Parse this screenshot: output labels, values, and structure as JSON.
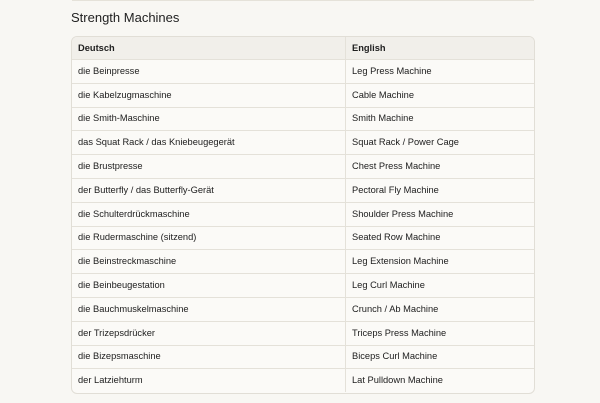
{
  "section": {
    "title": "Strength Machines"
  },
  "table": {
    "headers": [
      "Deutsch",
      "English"
    ],
    "rows": [
      [
        "die Beinpresse",
        "Leg Press Machine"
      ],
      [
        "die Kabelzugmaschine",
        "Cable Machine"
      ],
      [
        "die Smith-Maschine",
        "Smith Machine"
      ],
      [
        "das Squat Rack / das Kniebeugegerät",
        "Squat Rack / Power Cage"
      ],
      [
        "die Brustpresse",
        "Chest Press Machine"
      ],
      [
        "der Butterfly / das Butterfly-Gerät",
        "Pectoral Fly Machine"
      ],
      [
        "die Schulterdrückmaschine",
        "Shoulder Press Machine"
      ],
      [
        "die Rudermaschine (sitzend)",
        "Seated Row Machine"
      ],
      [
        "die Beinstreckmaschine",
        "Leg Extension Machine"
      ],
      [
        "die Beinbeugestation",
        "Leg Curl Machine"
      ],
      [
        "die Bauchmuskelmaschine",
        "Crunch / Ab Machine"
      ],
      [
        "der Trizepsdrücker",
        "Triceps Press Machine"
      ],
      [
        "die Bizepsmaschine",
        "Biceps Curl Machine"
      ],
      [
        "der Latziehturm",
        "Lat Pulldown Machine"
      ]
    ]
  }
}
